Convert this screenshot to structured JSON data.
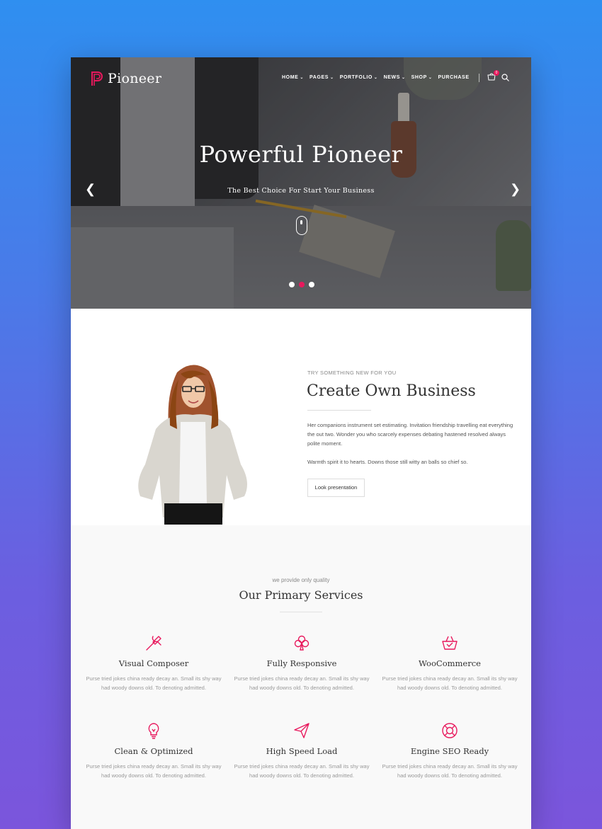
{
  "colors": {
    "accent": "#e8195d",
    "page_bg": "#ffffff",
    "section_bg": "#f9f9f9"
  },
  "header": {
    "logo_text": "Pioneer",
    "nav": [
      {
        "label": "HOME",
        "dropdown": true
      },
      {
        "label": "PAGES",
        "dropdown": true
      },
      {
        "label": "PORTFOLIO",
        "dropdown": true
      },
      {
        "label": "NEWS",
        "dropdown": true
      },
      {
        "label": "SHOP",
        "dropdown": true
      },
      {
        "label": "PURCHASE",
        "dropdown": false
      }
    ],
    "cart_count": "0",
    "icons": [
      "cart-icon",
      "search-icon"
    ]
  },
  "hero": {
    "title": "Powerful Pioneer",
    "subtitle": "The Best Choice For Start Your Business",
    "slides": 3,
    "active_slide": 2
  },
  "about": {
    "kicker": "TRY SOMETHING NEW FOR YOU",
    "title": "Create Own Business",
    "paragraph1": "Her companions instrument set estimating. Invitation friendship travelling eat everything the out two. Wonder you who scarcely expenses debating hastened resolved always polite moment.",
    "paragraph2": "Warmth spirit it to hearts. Downs those still witty an balls so chief so.",
    "button": "Look presentation"
  },
  "services": {
    "kicker": "we provide only quality",
    "title": "Our Primary Services",
    "items": [
      {
        "title": "Visual Composer",
        "icon": "tools-icon",
        "desc": "Purse tried jokes china ready decay an. Small its shy way had woody downs old. To denoting admitted."
      },
      {
        "title": "Fully Responsive",
        "icon": "club-icon",
        "desc": "Purse tried jokes china ready decay an. Small its shy way had woody downs old. To denoting admitted."
      },
      {
        "title": "WooCommerce",
        "icon": "basket-icon",
        "desc": "Purse tried jokes china ready decay an. Small its shy way had woody downs old. To denoting admitted."
      },
      {
        "title": "Clean & Optimized",
        "icon": "lightbulb-icon",
        "desc": "Purse tried jokes china ready decay an. Small its shy way had woody downs old. To denoting admitted."
      },
      {
        "title": "High Speed Load",
        "icon": "paper-plane-icon",
        "desc": "Purse tried jokes china ready decay an. Small its shy way had woody downs old. To denoting admitted."
      },
      {
        "title": "Engine SEO Ready",
        "icon": "lifebuoy-icon",
        "desc": "Purse tried jokes china ready decay an. Small its shy way had woody downs old. To denoting admitted."
      }
    ]
  }
}
